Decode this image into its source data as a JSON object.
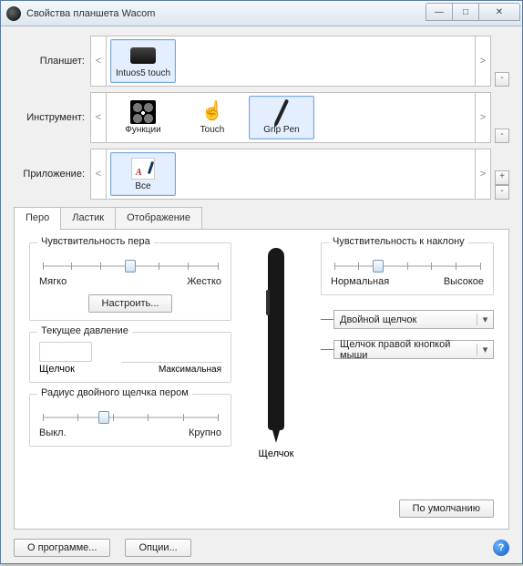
{
  "window": {
    "title": "Свойства планшета Wacom"
  },
  "selectors": {
    "tablet": {
      "label": "Планшет:",
      "items": [
        {
          "label": "Intuos5 touch",
          "selected": true
        }
      ]
    },
    "tool": {
      "label": "Инструмент:",
      "items": [
        {
          "label": "Функции",
          "selected": false
        },
        {
          "label": "Touch",
          "selected": false
        },
        {
          "label": "Grip Pen",
          "selected": true
        }
      ]
    },
    "app": {
      "label": "Приложение:",
      "items": [
        {
          "label": "Все",
          "selected": true
        }
      ]
    },
    "nav": {
      "prev": "<",
      "next": ">"
    },
    "plus": "+",
    "minus": "-"
  },
  "tabs": [
    {
      "id": "pen",
      "label": "Перо",
      "active": true
    },
    {
      "id": "eraser",
      "label": "Ластик",
      "active": false
    },
    {
      "id": "mapping",
      "label": "Отображение",
      "active": false
    }
  ],
  "pen": {
    "tip_feel": {
      "title": "Чувствительность пера",
      "left": "Мягко",
      "right": "Жестко",
      "customize_btn": "Настроить...",
      "value_pct": 50
    },
    "pressure": {
      "title": "Текущее давление",
      "left": "Щелчок",
      "right": "Максимальная"
    },
    "dblclick": {
      "title": "Радиус двойного щелчка пером",
      "left": "Выкл.",
      "right": "Крупно",
      "value_pct": 35
    },
    "tilt": {
      "title": "Чувствительность к наклону",
      "left": "Нормальная",
      "right": "Высокое",
      "value_pct": 30
    },
    "button_upper": {
      "selected": "Двойной щелчок"
    },
    "button_lower": {
      "selected": "Щелчок правой кнопкой мыши"
    },
    "tip_label": "Щелчок",
    "default_btn": "По умолчанию"
  },
  "footer": {
    "about_btn": "О программе...",
    "options_btn": "Опции..."
  }
}
